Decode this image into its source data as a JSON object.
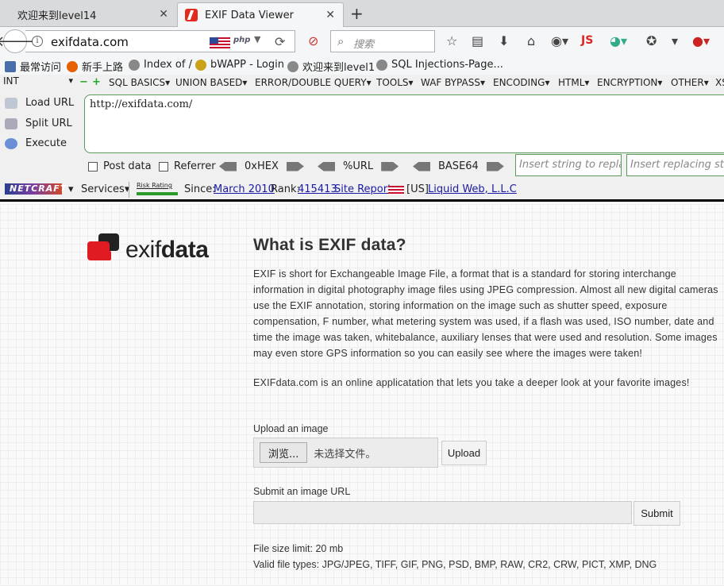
{
  "browser": {
    "tabs": [
      {
        "title": "欢迎来到level14",
        "active": false
      },
      {
        "title": "EXIF Data Viewer",
        "active": true
      }
    ],
    "url": "exifdata.com",
    "search_placeholder": "搜索",
    "php_badge": "php",
    "js_label": "JS"
  },
  "bookmarks": [
    "最常访问",
    "新手上路",
    "Index of /",
    "bWAPP - Login",
    "欢迎来到level1",
    "SQL Injections-Page..."
  ],
  "hackbar": {
    "type_select": "INT",
    "menus": [
      "SQL BASICS▾",
      "UNION BASED▾",
      "ERROR/DOUBLE QUERY▾",
      "TOOLS▾",
      "WAF BYPASS▾",
      "ENCODING▾",
      "HTML▾",
      "ENCRYPTION▾",
      "OTHER▾",
      "XS"
    ],
    "actions": [
      "Load URL",
      "Split URL",
      "Execute"
    ],
    "url_value": "http://exifdata.com/",
    "post_data": "Post data",
    "referrer": "Referrer",
    "encoders": [
      "0xHEX",
      "%URL",
      "BASE64"
    ],
    "insert_placeholder": "Insert string to replace",
    "replace_placeholder": "Insert replacing string"
  },
  "netcraft": {
    "logo": "NETCRAFT",
    "services": "Services▾",
    "risk_label": "Risk Rating",
    "since_label": "Since:",
    "since_value": "March 2010",
    "rank_label": "Rank:",
    "rank_value": "415413",
    "site_report": "Site Report",
    "country": "[US]",
    "host": "Liquid Web, L.L.C"
  },
  "page": {
    "logo_light": "exif",
    "logo_bold": "data",
    "heading": "What is EXIF data?",
    "intro": "EXIF is short for Exchangeable Image File, a format that is a standard for storing interchange information in digital photography image files using JPEG compression. Almost all new digital cameras use the EXIF annotation, storing information on the image such as shutter speed, exposure compensation, F number, what metering system was used, if a flash was used, ISO number, date and time the image was taken, whitebalance, auxiliary lenses that were used and resolution. Some images may even store GPS information so you can easily see where the images were taken!",
    "intro2": "EXIFdata.com is an online applicatation that lets you take a deeper look at your favorite images!",
    "upload_label": "Upload an image",
    "browse_label": "浏览...",
    "file_status": "未选择文件。",
    "upload_button": "Upload",
    "url_label": "Submit an image URL",
    "submit_button": "Submit",
    "size_limit": "File size limit: 20 mb",
    "file_types": "Valid file types: JPG/JPEG, TIFF, GIF, PNG, PSD, BMP, RAW, CR2, CRW, PICT, XMP, DNG"
  }
}
